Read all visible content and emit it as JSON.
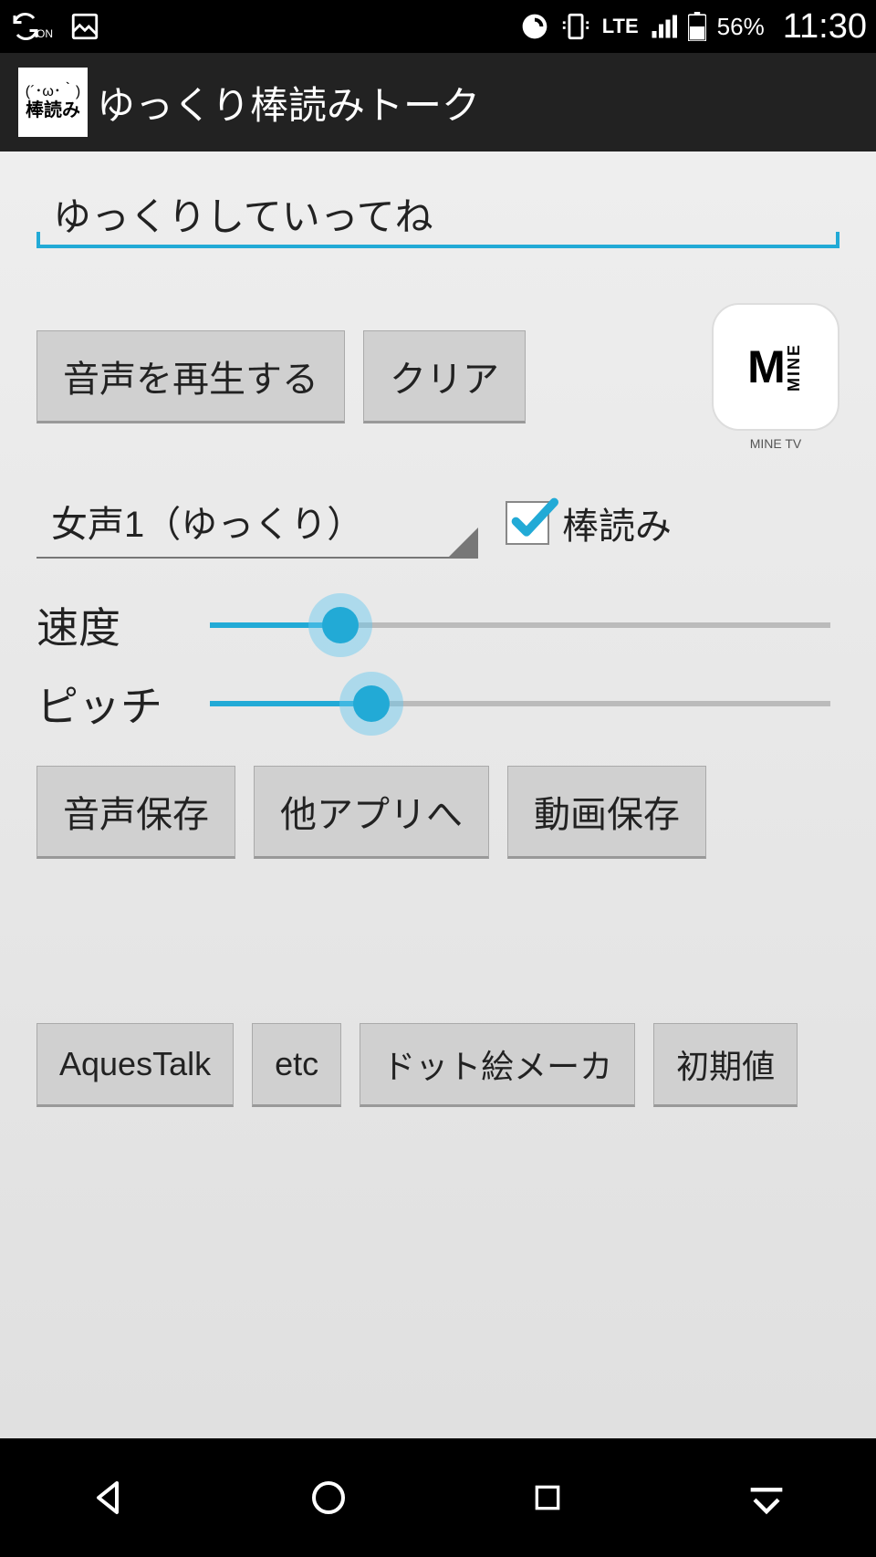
{
  "statusBar": {
    "lte": "LTE",
    "battery": "56%",
    "time": "11:30"
  },
  "header": {
    "iconTop": "(´･ω･｀)",
    "iconBottom": "棒読み",
    "title": "ゆっくり棒読みトーク"
  },
  "input": {
    "text": "ゆっくりしていってね"
  },
  "buttons": {
    "play": "音声を再生する",
    "clear": "クリア",
    "saveAudio": "音声保存",
    "otherApp": "他アプリへ",
    "saveVideo": "動画保存",
    "aques": "AquesTalk",
    "etc": "etc",
    "dotMaker": "ドット絵メーカ",
    "reset": "初期値"
  },
  "ad": {
    "letter": "M",
    "side": "MINE",
    "label": "MINE TV"
  },
  "voice": {
    "selected": "女声1（ゆっくり）",
    "monotoneLabel": "棒読み",
    "monotoneChecked": true
  },
  "sliders": {
    "speedLabel": "速度",
    "speedValue": 21,
    "pitchLabel": "ピッチ",
    "pitchValue": 26
  }
}
